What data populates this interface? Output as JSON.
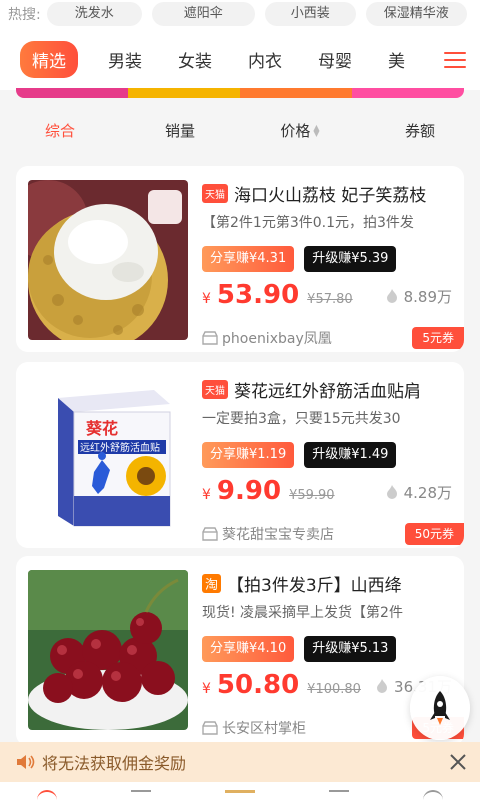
{
  "hot_search": {
    "label": "热搜:",
    "chips": [
      "洗发水",
      "遮阳伞",
      "小西装",
      "保湿精华液"
    ]
  },
  "categories": {
    "tabs": [
      "精选",
      "男装",
      "女装",
      "内衣",
      "母婴",
      "美"
    ],
    "active_index": 0
  },
  "banner_colors": [
    "#e63b8a",
    "#f5b400",
    "#ff7a2f",
    "#ff4ea1"
  ],
  "sort": {
    "items": [
      "综合",
      "销量",
      "价格",
      "券额"
    ],
    "active": "综合"
  },
  "products": [
    {
      "platform": "天猫",
      "title": "海口火山荔枝 妃子笑荔枝",
      "subtitle": "【第2件1元第3件0.1元，拍3件发",
      "share_earn": "分享赚¥4.31",
      "upgrade_earn": "升级赚¥5.39",
      "price_symbol": "¥",
      "price": "53.90",
      "orig_price": "¥57.80",
      "sales": "8.89万",
      "shop": "phoenixbay凤凰",
      "coupon": "5元券",
      "image": "lychee"
    },
    {
      "platform": "天猫",
      "title": "葵花远红外舒筋活血贴肩",
      "subtitle": "一定要拍3盒，只要15元共发30",
      "share_earn": "分享赚¥1.19",
      "upgrade_earn": "升级赚¥1.49",
      "price_symbol": "¥",
      "price": "9.90",
      "orig_price": "¥59.90",
      "sales": "4.28万",
      "shop": "葵花甜宝宝专卖店",
      "coupon": "50元券",
      "image": "patch-box",
      "box_brand": "葵花",
      "box_title": "远红外舒筋活血贴"
    },
    {
      "platform": "淘",
      "title": "【拍3件发3斤】山西绛",
      "subtitle": "现货! 凌晨采摘早上发货【第2件",
      "share_earn": "分享赚¥4.10",
      "upgrade_earn": "升级赚¥5.13",
      "price_symbol": "¥",
      "price": "50.80",
      "orig_price": "¥100.80",
      "sales": "36.31万",
      "shop": "长安区村掌柜",
      "coupon": "5元券",
      "image": "cherries"
    }
  ],
  "notice": {
    "text": "将无法获取佣金奖励",
    "icon": "speaker-icon"
  },
  "colors": {
    "accent": "#ff4f3b",
    "price": "#ff3a2f",
    "notice_bg": "#fce9d3"
  }
}
